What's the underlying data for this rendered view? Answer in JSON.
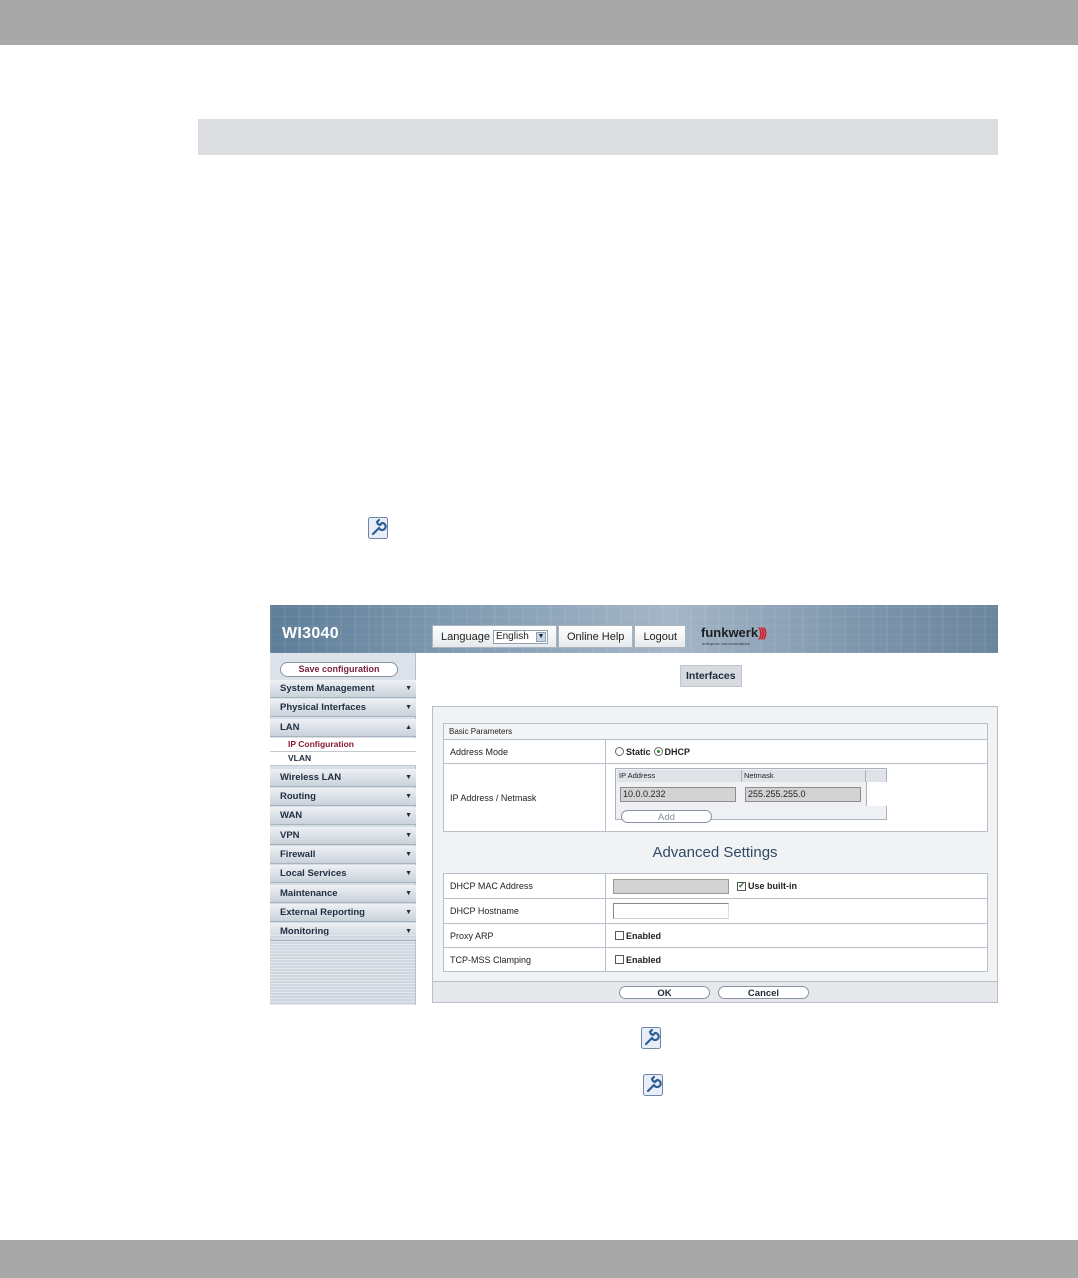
{
  "screenshot": {
    "model": "WI3040",
    "topnav": {
      "language_label": "Language",
      "language_value": "English",
      "online_help": "Online Help",
      "logout": "Logout"
    },
    "logo": {
      "name": "funkwerk",
      "tagline": "enterprise communications"
    },
    "sidebar": {
      "save_configuration": "Save configuration",
      "menu": {
        "system_management": "System Management",
        "physical_interfaces": "Physical Interfaces",
        "lan": "LAN",
        "lan_sub": [
          "IP Configuration",
          "VLAN"
        ],
        "wireless_lan": "Wireless LAN",
        "routing": "Routing",
        "wan": "WAN",
        "vpn": "VPN",
        "firewall": "Firewall",
        "local_services": "Local Services",
        "maintenance": "Maintenance",
        "external_reporting": "External Reporting",
        "monitoring": "Monitoring"
      }
    },
    "content": {
      "tab": "Interfaces",
      "basic_parameters": "Basic Parameters",
      "address_mode_label": "Address Mode",
      "address_mode_static": "Static",
      "address_mode_dhcp": "DHCP",
      "address_mode_selected": "DHCP",
      "ip_netmask_label": "IP Address / Netmask",
      "ip_col": "IP Address",
      "netmask_col": "Netmask",
      "ip_value": "10.0.0.232",
      "netmask_value": "255.255.255.0",
      "add_button": "Add",
      "advanced_settings": "Advanced Settings",
      "dhcp_mac_label": "DHCP MAC Address",
      "use_builtin": "Use built-in",
      "use_builtin_checked": true,
      "dhcp_hostname_label": "DHCP Hostname",
      "proxy_arp_label": "Proxy ARP",
      "tcp_mss_label": "TCP-MSS Clamping",
      "enabled": "Enabled",
      "ok_button": "OK",
      "cancel_button": "Cancel"
    }
  }
}
